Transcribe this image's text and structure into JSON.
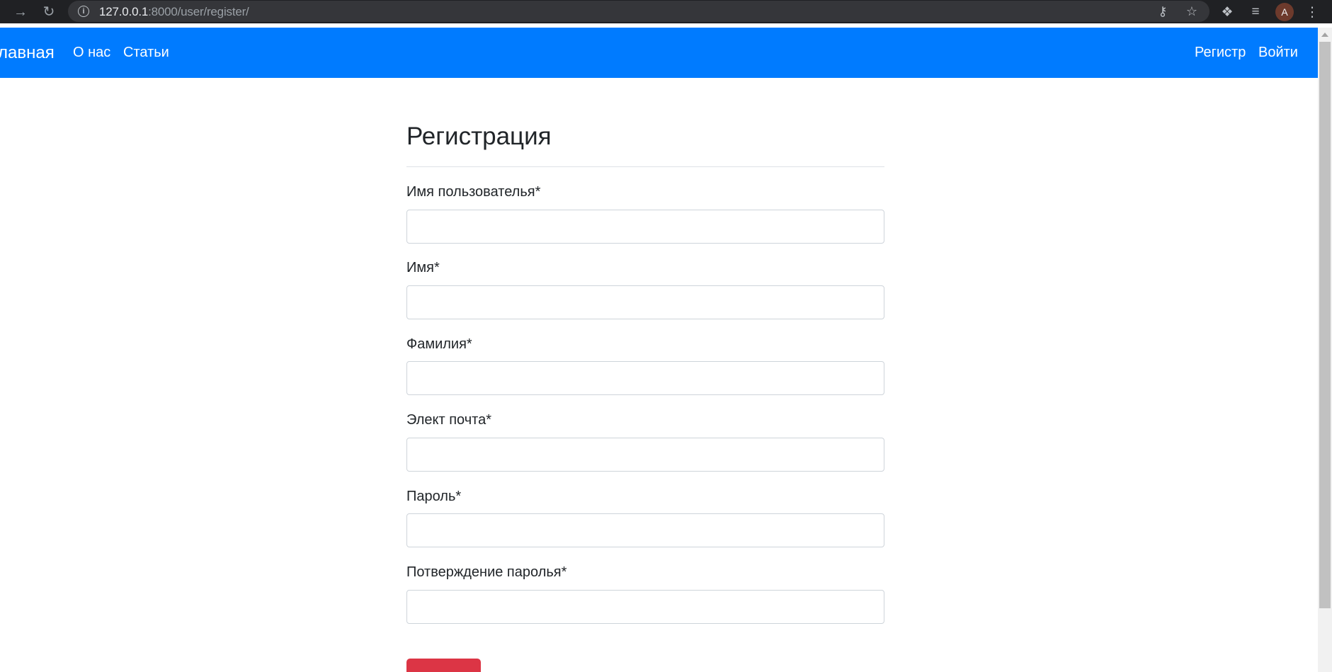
{
  "browser": {
    "url_host": "127.0.0.1",
    "url_rest": ":8000/user/register/",
    "avatar_letter": "A"
  },
  "navbar": {
    "brand": "лавная",
    "links_left": [
      "О нас",
      "Статьи"
    ],
    "links_right": [
      "Регистр",
      "Войти"
    ]
  },
  "form": {
    "title": "Регистрация",
    "fields": [
      {
        "label": "Имя пользователья*",
        "value": ""
      },
      {
        "label": "Имя*",
        "value": ""
      },
      {
        "label": "Фамилия*",
        "value": ""
      },
      {
        "label": "Элект почта*",
        "value": ""
      },
      {
        "label": "Пароль*",
        "value": ""
      },
      {
        "label": "Потверждение паролья*",
        "value": ""
      }
    ]
  },
  "colors": {
    "navbar": "#007bff",
    "submit": "#dc3545",
    "chrome": "#202124"
  }
}
